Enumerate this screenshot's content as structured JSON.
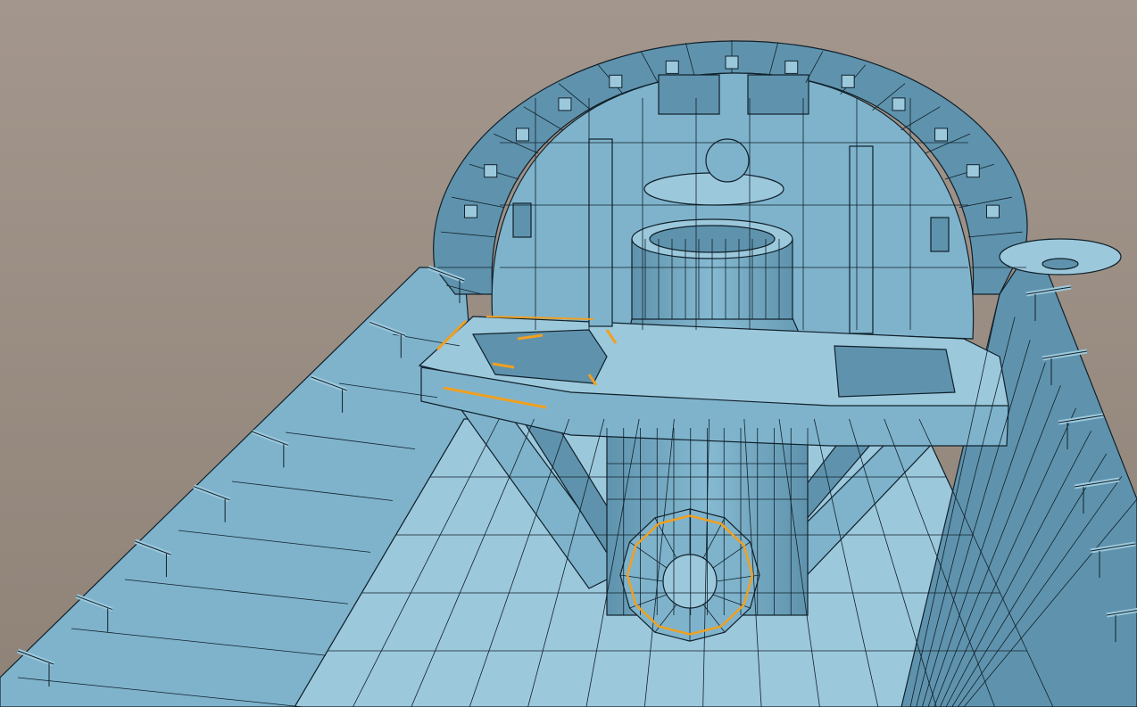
{
  "scene": {
    "background_top": "#a3968c",
    "background_bottom": "#8f8378",
    "model_fill": "#7fb3cc",
    "model_fill_light": "#9cc8dc",
    "model_fill_dark": "#5f93ad",
    "wire_color": "#10202a",
    "highlight_color": "#f0a020"
  }
}
